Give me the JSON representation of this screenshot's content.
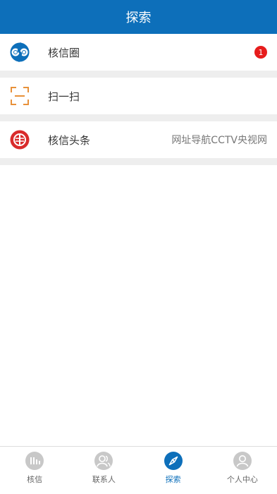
{
  "header": {
    "title": "探索"
  },
  "rows": {
    "circle": {
      "label": "核信圈",
      "badge": "1",
      "icon": "hexin-circle-icon"
    },
    "scan": {
      "label": "扫一扫",
      "icon": "scan-icon"
    },
    "news": {
      "label": "核信头条",
      "right_text": "网址导航CCTV央视网",
      "icon": "hexin-news-icon"
    }
  },
  "tabs": [
    {
      "label": "核信",
      "icon": "chat-icon",
      "active": false
    },
    {
      "label": "联系人",
      "icon": "contacts-icon",
      "active": false
    },
    {
      "label": "探索",
      "icon": "compass-icon",
      "active": true
    },
    {
      "label": "个人中心",
      "icon": "profile-icon",
      "active": false
    }
  ],
  "colors": {
    "accent": "#0d6fba",
    "badge": "#e61c1c",
    "scan_icon": "#e8913a",
    "news_icon": "#d92b2b",
    "inactive_icon": "#c8c8c8"
  }
}
